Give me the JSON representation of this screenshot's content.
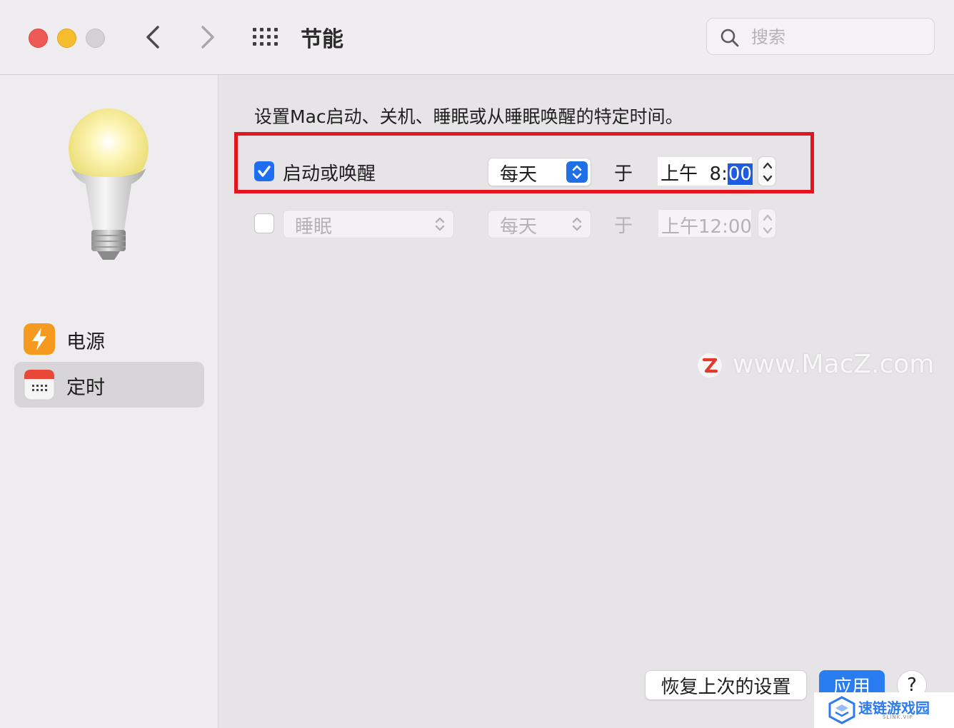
{
  "window": {
    "title": "节能",
    "search_placeholder": "搜索"
  },
  "sidebar": {
    "items": [
      {
        "label": "电源",
        "icon": "power-bolt-icon",
        "selected": false
      },
      {
        "label": "定时",
        "icon": "calendar-icon",
        "selected": true
      }
    ]
  },
  "main": {
    "description": "设置Mac启动、关机、睡眠或从睡眠唤醒的特定时间。",
    "rows": [
      {
        "checked": true,
        "label": "启动或唤醒",
        "frequency": "每天",
        "at_label": "于",
        "time_prefix": "上午  8:",
        "time_selected": "00"
      },
      {
        "checked": false,
        "action": "睡眠",
        "frequency": "每天",
        "at_label": "于",
        "time": "上午12:00"
      }
    ]
  },
  "watermark": {
    "text": "www.MacZ.com"
  },
  "footer": {
    "revert_label": "恢复上次的设置",
    "apply_label": "应用",
    "help_label": "?"
  },
  "badge": {
    "text": "速链游戏园",
    "sub": "SLINK.VIP"
  },
  "colors": {
    "accent": "#1d6ef0",
    "highlight_border": "#e3161f",
    "apply_button": "#2a7df1"
  }
}
